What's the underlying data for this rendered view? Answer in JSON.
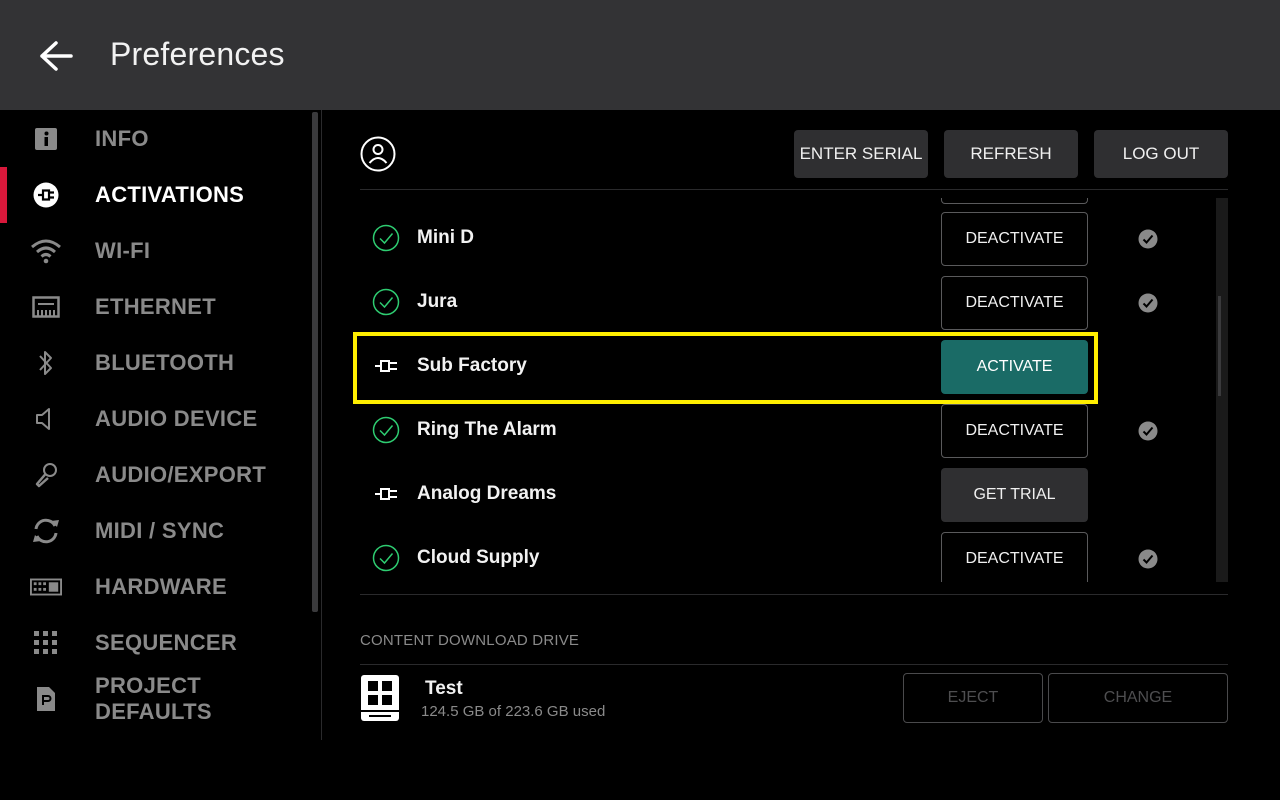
{
  "header": {
    "title": "Preferences",
    "back_icon": "arrow-left-icon"
  },
  "sidebar": {
    "accent_color": "#d8183b",
    "items": [
      {
        "label": "INFO",
        "icon": "info-icon",
        "active": false
      },
      {
        "label": "ACTIVATIONS",
        "icon": "plug-icon",
        "active": true
      },
      {
        "label": "WI-FI",
        "icon": "wifi-icon",
        "active": false
      },
      {
        "label": "ETHERNET",
        "icon": "ethernet-icon",
        "active": false
      },
      {
        "label": "BLUETOOTH",
        "icon": "bluetooth-icon",
        "active": false
      },
      {
        "label": "AUDIO DEVICE",
        "icon": "speaker-icon",
        "active": false
      },
      {
        "label": "AUDIO/EXPORT",
        "icon": "microphone-icon",
        "active": false
      },
      {
        "label": "MIDI / SYNC",
        "icon": "sync-icon",
        "active": false
      },
      {
        "label": "HARDWARE",
        "icon": "keyboard-icon",
        "active": false
      },
      {
        "label": "SEQUENCER",
        "icon": "grid-icon",
        "active": false
      },
      {
        "label": "PROJECT DEFAULTS",
        "icon": "document-icon",
        "active": false
      }
    ]
  },
  "toolbar": {
    "account_icon": "user-circle-icon",
    "enter_serial": "ENTER SERIAL",
    "refresh": "REFRESH",
    "log_out": "LOG OUT"
  },
  "activations": {
    "rows": [
      {
        "name": "Mini D",
        "status": "activated",
        "action": "DEACTIVATE",
        "verified": true
      },
      {
        "name": "Jura",
        "status": "activated",
        "action": "DEACTIVATE",
        "verified": true
      },
      {
        "name": "Sub Factory",
        "status": "not-activated",
        "action": "ACTIVATE",
        "verified": false,
        "highlighted": true
      },
      {
        "name": "Ring The Alarm",
        "status": "activated",
        "action": "DEACTIVATE",
        "verified": true
      },
      {
        "name": "Analog Dreams",
        "status": "not-activated",
        "action": "GET TRIAL",
        "verified": false
      },
      {
        "name": "Cloud Supply",
        "status": "activated",
        "action": "DEACTIVATE",
        "verified": true
      }
    ],
    "highlight_color": "#ffee00",
    "activate_color": "#1a6b66",
    "check_color": "#2ecc71"
  },
  "drive": {
    "heading": "CONTENT DOWNLOAD DRIVE",
    "name": "Test",
    "usage": "124.5 GB of 223.6 GB used",
    "eject": "EJECT",
    "change": "CHANGE"
  }
}
